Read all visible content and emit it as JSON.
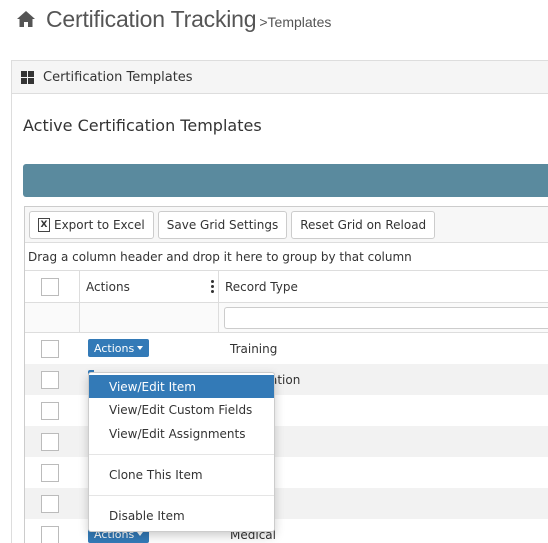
{
  "header": {
    "title": "Certification Tracking",
    "separator": ">",
    "breadcrumb": "Templates"
  },
  "panel": {
    "title": "Certification Templates",
    "section_title": "Active Certification Templates"
  },
  "toolbar": {
    "export_label": "Export to Excel",
    "export_icon_glyph": "X",
    "save_label": "Save Grid Settings",
    "reset_label": "Reset Grid on Reload"
  },
  "grid": {
    "group_hint": "Drag a column header and drop it here to group by that column",
    "columns": {
      "actions": "Actions",
      "record_type": "Record Type"
    },
    "actions_button_label": "Actions",
    "rows": [
      {
        "record_type": "Training"
      },
      {
        "record_type": "ation"
      },
      {
        "record_type": ""
      },
      {
        "record_type": ""
      },
      {
        "record_type": ""
      },
      {
        "record_type": ""
      },
      {
        "record_type": "Medical"
      }
    ]
  },
  "menu": {
    "items": [
      "View/Edit Item",
      "View/Edit Custom Fields",
      "View/Edit Assignments",
      "Clone This Item",
      "Disable Item"
    ]
  },
  "colors": {
    "accent": "#337ab7",
    "bar": "#5a8a9e"
  }
}
